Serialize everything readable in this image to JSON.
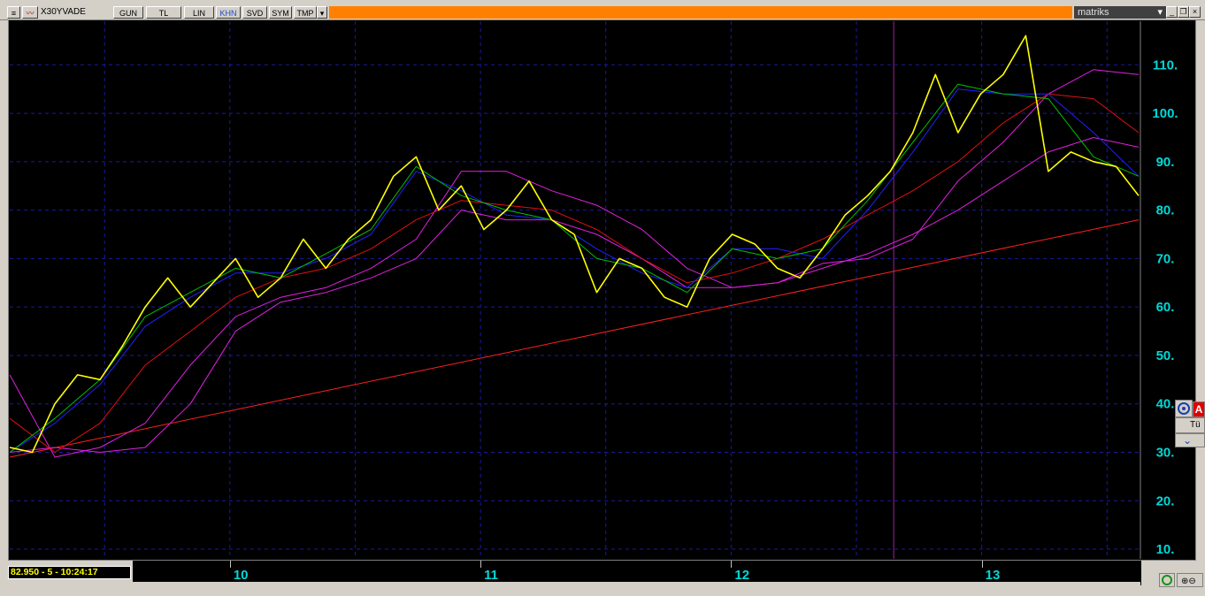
{
  "toolbar": {
    "symbol": "X30YVADE",
    "buttons": [
      "GUN",
      "TL",
      "LIN",
      "KHN",
      "SVD",
      "SYM",
      "TMP"
    ],
    "active_button": "KHN",
    "brand": "matriks"
  },
  "status": {
    "readout": "82.950 - 5 - 10:24:17"
  },
  "side_panel": {
    "letter": "A",
    "text": "Tü"
  },
  "colors": {
    "background": "#000000",
    "price_line": "#ffff00",
    "ma_green": "#00c000",
    "ma_blue": "#2020ff",
    "ma_red": "#e01010",
    "ma_magenta": "#e020e0",
    "trendline": "#ff2020",
    "grid": "#1a1aa0",
    "axis_text": "#00d8d8",
    "orange_bar": "#ff8000"
  },
  "chart_data": {
    "type": "line",
    "title": "",
    "xlabel": "",
    "ylabel": "",
    "x_tick_labels": [
      "10",
      "11",
      "12",
      "13"
    ],
    "y_ticks": [
      10,
      20,
      30,
      40,
      50,
      60,
      70,
      80,
      90,
      100,
      110
    ],
    "y_tick_labels": [
      "10.",
      "20.",
      "30.",
      "40.",
      "50.",
      "60.",
      "70.",
      "80.",
      "90.",
      "100.",
      "110."
    ],
    "ylim": [
      8,
      119
    ],
    "xlim": [
      0,
      100
    ],
    "grid": true,
    "series": [
      {
        "key": "price",
        "x": [
          0,
          2,
          4,
          6,
          8,
          10,
          12,
          14,
          16,
          18,
          20,
          22,
          24,
          26,
          28,
          30,
          32,
          34,
          36,
          38,
          40,
          42,
          44,
          46,
          48,
          50,
          52,
          54,
          56,
          58,
          60,
          62,
          64,
          66,
          68,
          70,
          72,
          74,
          76,
          78,
          80,
          82,
          84,
          86,
          88,
          90,
          92,
          94,
          96,
          98,
          100
        ],
        "values": [
          31,
          30,
          40,
          46,
          45,
          52,
          60,
          66,
          60,
          65,
          70,
          62,
          66,
          74,
          68,
          74,
          78,
          87,
          91,
          80,
          85,
          76,
          80,
          86,
          78,
          75,
          63,
          70,
          68,
          62,
          60,
          70,
          75,
          73,
          68,
          66,
          72,
          79,
          83,
          88,
          96,
          108,
          96,
          104,
          108,
          116,
          88,
          92,
          90,
          89,
          83
        ]
      },
      {
        "key": "ma_short",
        "x": [
          0,
          4,
          8,
          12,
          16,
          20,
          24,
          28,
          32,
          36,
          40,
          44,
          48,
          52,
          56,
          60,
          64,
          68,
          72,
          76,
          80,
          84,
          88,
          92,
          96,
          100
        ],
        "values": [
          30,
          37,
          45,
          58,
          63,
          68,
          66,
          71,
          76,
          89,
          83,
          80,
          78,
          70,
          68,
          63,
          72,
          70,
          72,
          82,
          94,
          106,
          104,
          103,
          91,
          87
        ]
      },
      {
        "key": "ma_blue",
        "x": [
          0,
          4,
          8,
          12,
          16,
          20,
          24,
          28,
          32,
          36,
          40,
          44,
          48,
          52,
          56,
          60,
          64,
          68,
          72,
          76,
          80,
          84,
          88,
          92,
          96,
          100
        ],
        "values": [
          30,
          36,
          44,
          56,
          62,
          67,
          67,
          70,
          75,
          88,
          84,
          79,
          78,
          72,
          67,
          64,
          72,
          72,
          70,
          80,
          92,
          105,
          104,
          104,
          96,
          87
        ]
      },
      {
        "key": "ma_mid",
        "x": [
          0,
          4,
          8,
          12,
          16,
          20,
          24,
          28,
          32,
          36,
          40,
          44,
          48,
          52,
          56,
          60,
          64,
          68,
          72,
          76,
          80,
          84,
          88,
          92,
          96,
          100
        ],
        "values": [
          37,
          30,
          36,
          48,
          55,
          62,
          66,
          68,
          72,
          78,
          82,
          81,
          80,
          76,
          70,
          65,
          67,
          70,
          74,
          79,
          84,
          90,
          98,
          104,
          103,
          96
        ]
      },
      {
        "key": "ma_long",
        "x": [
          0,
          4,
          8,
          12,
          16,
          20,
          24,
          28,
          32,
          36,
          40,
          44,
          48,
          52,
          56,
          60,
          64,
          68,
          72,
          76,
          80,
          84,
          88,
          92,
          96,
          100
        ],
        "values": [
          46,
          29,
          31,
          36,
          48,
          58,
          62,
          64,
          68,
          74,
          88,
          88,
          84,
          81,
          76,
          68,
          64,
          65,
          69,
          70,
          74,
          86,
          94,
          104,
          109,
          108
        ]
      },
      {
        "key": "ma_long_2",
        "x": [
          0,
          4,
          8,
          12,
          16,
          20,
          24,
          28,
          32,
          36,
          40,
          44,
          48,
          52,
          56,
          60,
          64,
          68,
          72,
          76,
          80,
          84,
          88,
          92,
          96,
          100
        ],
        "values": [
          30,
          31,
          30,
          31,
          40,
          55,
          61,
          63,
          66,
          70,
          80,
          78,
          78,
          75,
          70,
          64,
          64,
          65,
          68,
          71,
          75,
          80,
          86,
          92,
          95,
          93
        ]
      },
      {
        "key": "trendline",
        "x": [
          0,
          100
        ],
        "values": [
          29,
          78
        ]
      }
    ],
    "cursor_x": 78.3,
    "vertical_marker_x": 78.3
  }
}
